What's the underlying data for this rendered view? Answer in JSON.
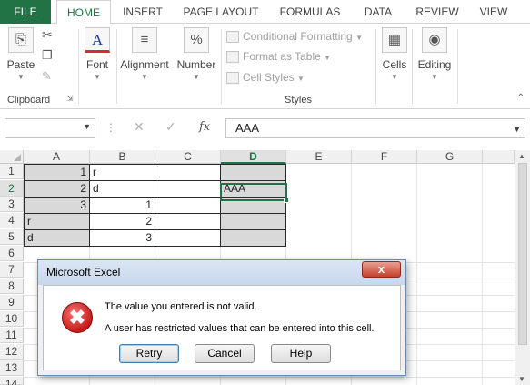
{
  "ribbon": {
    "file_tab": "FILE",
    "tabs": [
      "HOME",
      "INSERT",
      "PAGE LAYOUT",
      "FORMULAS",
      "DATA",
      "REVIEW",
      "VIEW"
    ],
    "active_tab": "HOME",
    "clipboard": {
      "paste_label": "Paste",
      "group_label": "Clipboard"
    },
    "font": {
      "label": "Font"
    },
    "alignment": {
      "label": "Alignment"
    },
    "number": {
      "label": "Number"
    },
    "styles": {
      "conditional_formatting": "Conditional Formatting",
      "format_as_table": "Format as Table",
      "cell_styles": "Cell Styles",
      "group_label": "Styles"
    },
    "cells": {
      "label": "Cells"
    },
    "editing": {
      "label": "Editing"
    }
  },
  "formula_bar": {
    "name_box": "",
    "fx_label": "fx",
    "value": "AAA"
  },
  "sheet": {
    "columns": [
      "A",
      "B",
      "C",
      "D",
      "E",
      "F",
      "G"
    ],
    "selected_column": "D",
    "rows": [
      "1",
      "2",
      "3",
      "4",
      "5",
      "6",
      "7",
      "8",
      "9",
      "10",
      "11",
      "12",
      "13",
      "14"
    ],
    "selected_row": "2",
    "cells": {
      "A1": "1",
      "B1": "r",
      "A2": "2",
      "B2": "d",
      "D2": "AAA",
      "A3": "3",
      "B3": "1",
      "A4": "r",
      "B4": "2",
      "A5": "d",
      "B5": "3"
    }
  },
  "dialog": {
    "title": "Microsoft Excel",
    "close_symbol": "x",
    "message_line1": "The value you entered is not valid.",
    "message_line2": "A user has restricted values that can be entered into this cell.",
    "buttons": [
      "Retry",
      "Cancel",
      "Help"
    ],
    "icon": "error-x-icon"
  },
  "colors": {
    "excel_green": "#217346",
    "cell_shade": "#d9d9d9",
    "error_red": "#c81a1a"
  }
}
